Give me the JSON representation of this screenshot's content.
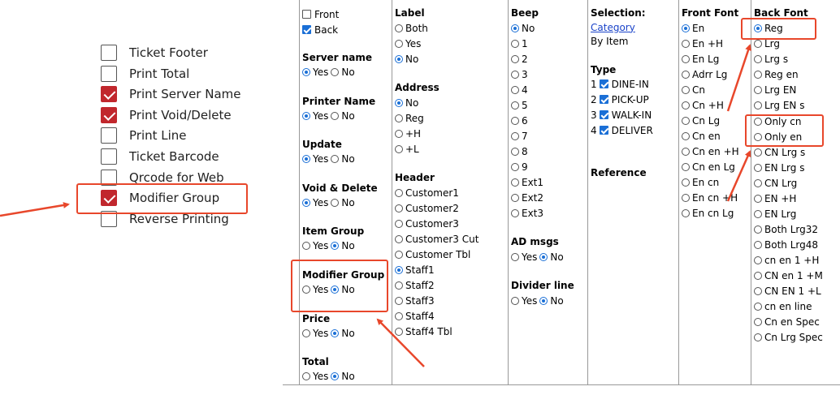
{
  "checklist": {
    "items": [
      {
        "label": "Ticket Footer",
        "checked": false
      },
      {
        "label": "Print Total",
        "checked": false
      },
      {
        "label": "Print Server Name",
        "checked": true
      },
      {
        "label": "Print Void/Delete",
        "checked": true
      },
      {
        "label": "Print Line",
        "checked": false
      },
      {
        "label": "Ticket Barcode",
        "checked": false
      },
      {
        "label": "Qrcode for Web",
        "checked": false
      },
      {
        "label": "Modifier Group",
        "checked": true
      },
      {
        "label": "Reverse Printing",
        "checked": false
      }
    ]
  },
  "col1": {
    "front": "Front",
    "back": "Back",
    "server_name": "Server name",
    "printer_name": "Printer Name",
    "update": "Update",
    "void_delete": "Void & Delete",
    "item_group": "Item Group",
    "modifier_group": "Modifier Group",
    "price": "Price",
    "total": "Total",
    "yes": "Yes",
    "no": "No"
  },
  "col2": {
    "label": "Label",
    "both": "Both",
    "yes": "Yes",
    "no": "No",
    "address": "Address",
    "addr_no": "No",
    "addr_reg": "Reg",
    "addr_h": "+H",
    "addr_l": "+L",
    "header": "Header",
    "headers": [
      "Customer1",
      "Customer2",
      "Customer3",
      "Customer3 Cut",
      "Customer Tbl",
      "Staff1",
      "Staff2",
      "Staff3",
      "Staff4",
      "Staff4 Tbl"
    ]
  },
  "col3": {
    "beep": "Beep",
    "beeps": [
      "No",
      "1",
      "2",
      "3",
      "4",
      "5",
      "6",
      "7",
      "8",
      "9",
      "Ext1",
      "Ext2",
      "Ext3"
    ],
    "ad_msgs": "AD msgs",
    "divider_line": "Divider line",
    "yes": "Yes",
    "no": "No"
  },
  "col4": {
    "selection": "Selection:",
    "category": "Category",
    "by_item": "By Item",
    "type": "Type",
    "types": [
      {
        "n": "1",
        "label": "DINE-IN"
      },
      {
        "n": "2",
        "label": "PICK-UP"
      },
      {
        "n": "3",
        "label": "WALK-IN"
      },
      {
        "n": "4",
        "label": "DELIVER"
      }
    ],
    "reference": "Reference"
  },
  "col5": {
    "front_font": "Front Font",
    "fonts": [
      "En",
      "En +H",
      "En Lg",
      "Adrr Lg",
      "Cn",
      "Cn +H",
      "Cn Lg",
      "Cn en",
      "Cn en +H",
      "Cn en Lg",
      "En cn",
      "En cn +H",
      "En cn Lg"
    ]
  },
  "col6": {
    "back_font": "Back Font",
    "fonts": [
      "Reg",
      "Lrg",
      "Lrg s",
      "Reg en",
      "Lrg EN",
      "Lrg EN s",
      "Only cn",
      "Only en",
      "CN Lrg s",
      "EN Lrg s",
      "CN Lrg",
      "EN +H",
      "EN Lrg",
      "Both Lrg32",
      "Both Lrg48",
      "cn en 1 +H",
      "CN en 1 +M",
      "CN EN 1 +L",
      "cn en line",
      "Cn en Spec",
      "Cn Lrg Spec"
    ]
  },
  "colors": {
    "accent": "#1a6fd6",
    "annotation": "#e8472b",
    "check_red": "#c1272d"
  }
}
